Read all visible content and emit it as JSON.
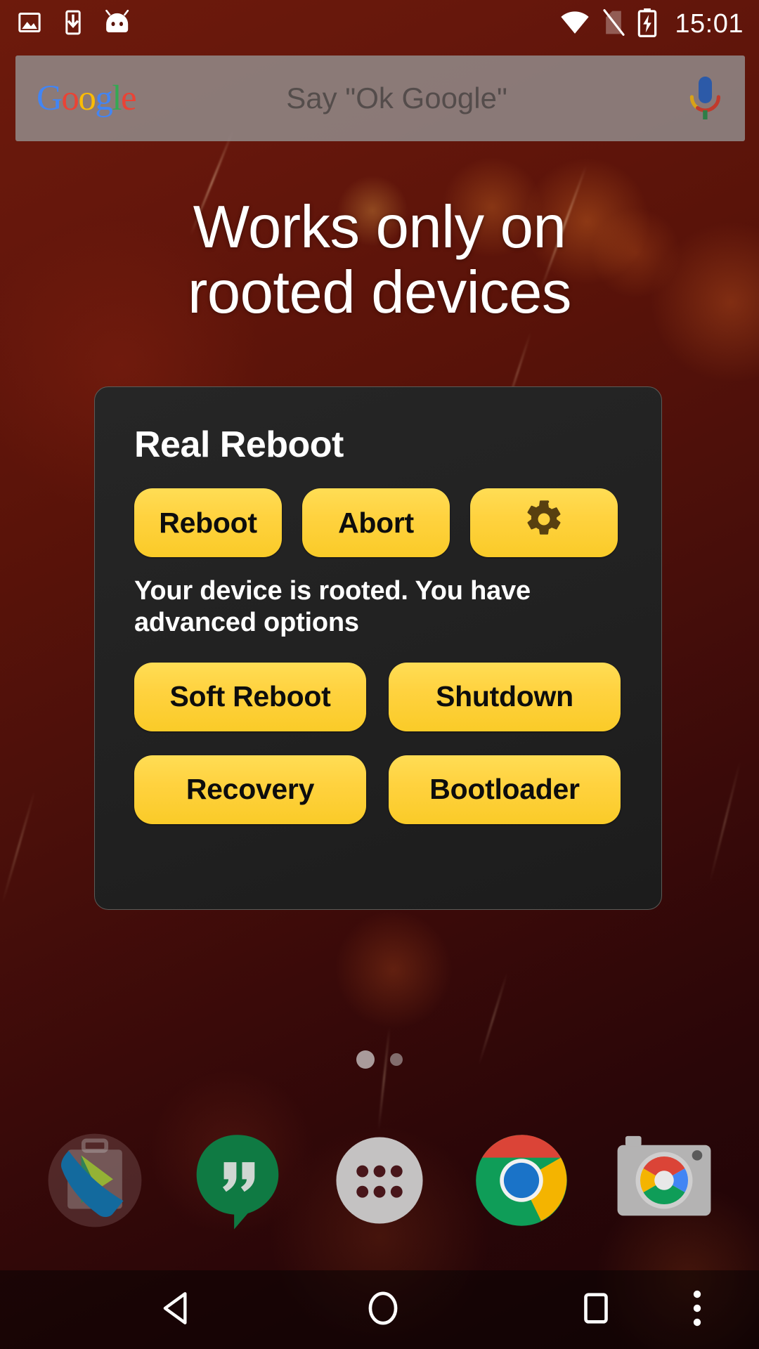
{
  "statusbar": {
    "time": "15:01",
    "left_icons": [
      {
        "name": "screenshot-icon",
        "label": "screenshot"
      },
      {
        "name": "download-icon",
        "label": "download"
      },
      {
        "name": "android-head-icon",
        "label": "android-system"
      }
    ],
    "right_icons": [
      {
        "name": "wifi-icon",
        "label": "wifi-full"
      },
      {
        "name": "no-sim-icon",
        "label": "no-sim-card"
      },
      {
        "name": "battery-charging-icon",
        "label": "battery-charging"
      }
    ]
  },
  "search_widget": {
    "logo_letters": [
      "G",
      "o",
      "o",
      "g",
      "l",
      "e"
    ],
    "placeholder": "Say \"Ok Google\"",
    "mic_icon": "microphone-icon"
  },
  "headline": {
    "line1": "Works only on",
    "line2": "rooted devices"
  },
  "widget": {
    "title": "Real Reboot",
    "primary_buttons": [
      {
        "label": "Reboot",
        "name": "reboot-button"
      },
      {
        "label": "Abort",
        "name": "abort-button"
      },
      {
        "label": "",
        "name": "settings-gear-button",
        "icon": "gear-icon"
      }
    ],
    "status_message": "Your device is rooted. You have advanced options",
    "advanced_buttons_row1": [
      {
        "label": "Soft Reboot",
        "name": "soft-reboot-button"
      },
      {
        "label": "Shutdown",
        "name": "shutdown-button"
      }
    ],
    "advanced_buttons_row2": [
      {
        "label": "Recovery",
        "name": "recovery-button"
      },
      {
        "label": "Bootloader",
        "name": "bootloader-button"
      }
    ],
    "colors": {
      "button_top": "#FFDD55",
      "button_bottom": "#FACB28",
      "card_bg": "#212121",
      "card_border": "#5c5c58",
      "button_text": "#0d0d0d"
    }
  },
  "page_indicator": {
    "pages": 2,
    "current": 1
  },
  "dock": {
    "items": [
      {
        "name": "dock-item-phone-play",
        "label": "Phone"
      },
      {
        "name": "dock-item-hangouts",
        "label": "Hangouts"
      },
      {
        "name": "dock-item-app-drawer",
        "label": "Apps"
      },
      {
        "name": "dock-item-chrome",
        "label": "Chrome"
      },
      {
        "name": "dock-item-camera",
        "label": "Camera"
      }
    ]
  },
  "navbar": {
    "items": [
      {
        "name": "nav-back-button",
        "label": "Back"
      },
      {
        "name": "nav-home-button",
        "label": "Home"
      },
      {
        "name": "nav-recents-button",
        "label": "Recents"
      },
      {
        "name": "nav-overflow-menu-button",
        "label": "More options"
      }
    ]
  }
}
